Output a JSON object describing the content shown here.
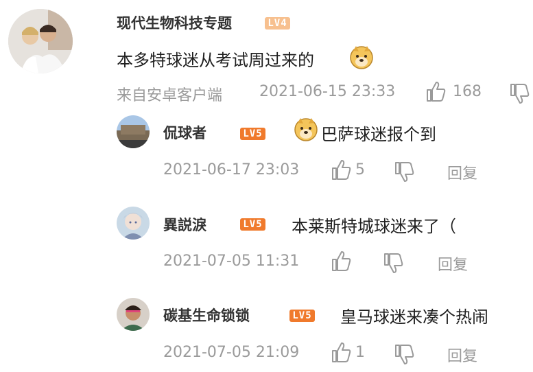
{
  "colors": {
    "accent": "#f07a2c",
    "muted": "#9a9a9a",
    "text": "#1f1f1f"
  },
  "main_comment": {
    "username": "现代生物科技专题",
    "level": "LV4",
    "text": "本多特球迷从考试周过来的",
    "emoji": "doge-emoji",
    "source": "来自安卓客户端",
    "timestamp": "2021-06-15 23:33",
    "likes": "168"
  },
  "replies": [
    {
      "username": "侃球者",
      "level": "LV5",
      "emoji": "doge-emoji",
      "text": "巴萨球迷报个到",
      "timestamp": "2021-06-17 23:03",
      "likes": "5",
      "reply_label": "回复"
    },
    {
      "username": "異説淚",
      "level": "LV5",
      "text": "本莱斯特城球迷来了（",
      "timestamp": "2021-07-05 11:31",
      "likes": "",
      "reply_label": "回复"
    },
    {
      "username": "碳基生命锁锁",
      "level": "LV5",
      "text": "皇马球迷来凑个热闹",
      "timestamp": "2021-07-05 21:09",
      "likes": "1",
      "reply_label": "回复"
    }
  ]
}
